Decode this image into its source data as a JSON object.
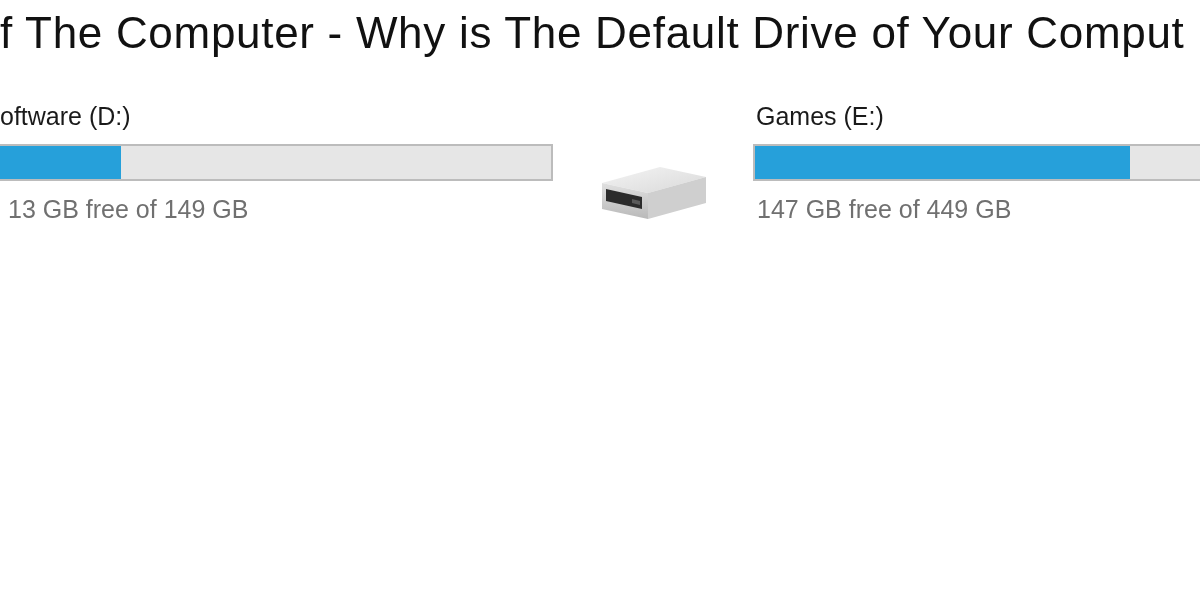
{
  "article_title": "f The Computer - Why is The Default Drive of Your Comput",
  "drives": [
    {
      "label": "oftware (D:)",
      "level": 0.22,
      "free_text": "13 GB free of 149 GB"
    },
    {
      "label": "Games (E:)",
      "level": 0.84,
      "free_text": "147 GB free of 449 GB"
    }
  ]
}
